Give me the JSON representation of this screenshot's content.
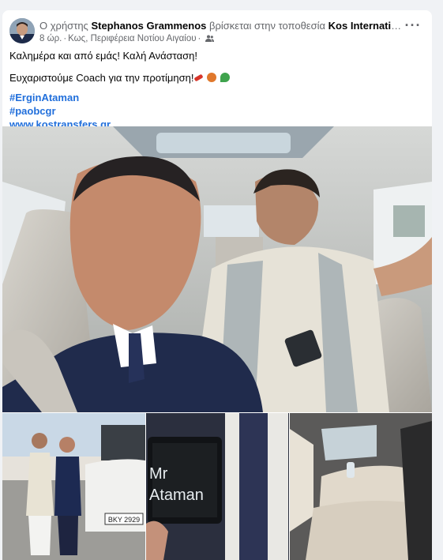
{
  "post": {
    "author_prefix": "Ο χρήστης",
    "author": "Stephanos Grammenos",
    "location_prefix": "βρίσκεται στην τοποθεσία",
    "location": "Kos International Air...",
    "time": "8 ώρ.",
    "place": "Κως, Περιφέρεια Νοτίου Αιγαίου",
    "audience_icon": "friends-icon",
    "more_icon": "more-options-icon",
    "line1": "Καλημέρα και από εμάς! Καλή Ανάσταση!",
    "line2": "Ευχαριστούμε Coach για την προτίμηση!",
    "emojis": [
      "firecracker",
      "basketball",
      "shamrock"
    ],
    "hashtags": [
      "#ErginAtaman",
      "#paobcgr"
    ],
    "website": "www.kostransfers.gr"
  },
  "photos": {
    "tablet_text_line1": "Mr",
    "tablet_text_line2": "Ataman",
    "license_plate": "ΒΚΥ 2929"
  },
  "colors": {
    "link": "#216fdb",
    "text": "#050505",
    "secondary": "#65676b",
    "background": "#f0f2f5"
  }
}
